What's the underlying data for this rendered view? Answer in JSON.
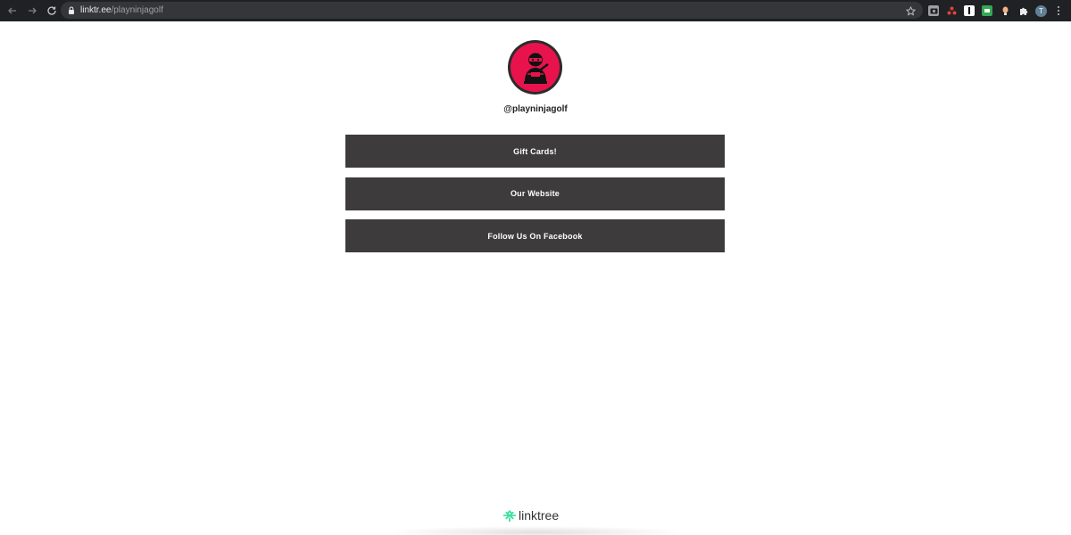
{
  "browser": {
    "url_host": "linktr.ee",
    "url_path": "/playninjagolf",
    "profile_initial": "T"
  },
  "profile": {
    "username": "@playninjagolf",
    "avatar_bg": "#e8134d"
  },
  "links": [
    {
      "label": "Gift Cards!"
    },
    {
      "label": "Our Website"
    },
    {
      "label": "Follow Us On Facebook"
    }
  ],
  "footer": {
    "brand": "linktree",
    "brand_color": "#39e09b"
  }
}
